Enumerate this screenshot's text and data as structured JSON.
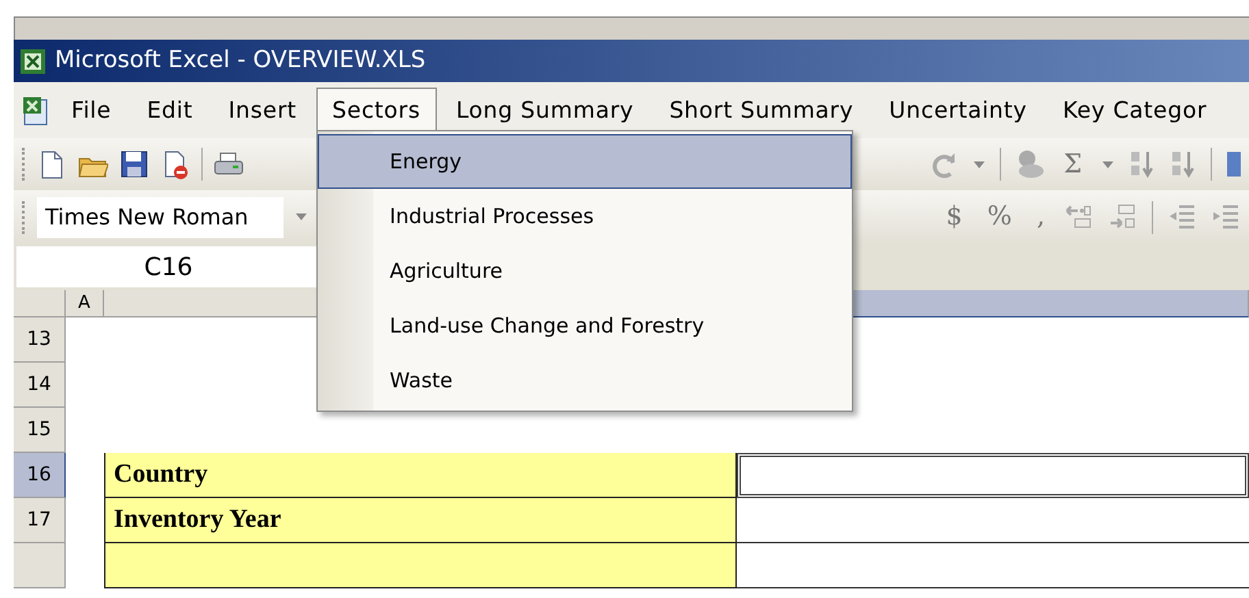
{
  "window": {
    "title": "Microsoft Excel - OVERVIEW.XLS"
  },
  "menu_bar": [
    {
      "label": "File",
      "selected": false
    },
    {
      "label": "Edit",
      "selected": false
    },
    {
      "label": "Insert",
      "selected": false
    },
    {
      "label": "Sectors",
      "selected": true
    },
    {
      "label": "Long Summary",
      "selected": false
    },
    {
      "label": "Short Summary",
      "selected": false
    },
    {
      "label": "Uncertainty",
      "selected": false
    },
    {
      "label": "Key Categor",
      "selected": false
    }
  ],
  "open_menu": {
    "items": [
      {
        "label": "Energy",
        "selected": true
      },
      {
        "label": "Industrial Processes",
        "selected": false
      },
      {
        "label": "Agriculture",
        "selected": false
      },
      {
        "label": "Land-use Change and Forestry",
        "selected": false
      },
      {
        "label": "Waste",
        "selected": false
      }
    ]
  },
  "standard_toolbar": {
    "autosum": "Σ"
  },
  "formatting_toolbar": {
    "font": "Times New Roman",
    "buttons": [
      "$",
      "%",
      ","
    ]
  },
  "name_box": "C16",
  "columns": [
    {
      "label": "A",
      "selected": false
    },
    {
      "selected": false
    },
    {
      "selected": true
    }
  ],
  "rows": [
    {
      "number": "13",
      "kind": "blank",
      "selected": false
    },
    {
      "number": "14",
      "kind": "blank",
      "selected": false
    },
    {
      "number": "15",
      "kind": "blank",
      "selected": false
    },
    {
      "number": "16",
      "kind": "field",
      "selected": true,
      "label": "Country"
    },
    {
      "number": "17",
      "kind": "field",
      "selected": false,
      "label": "Inventory Year"
    },
    {
      "kind": "field",
      "selected": false
    }
  ]
}
